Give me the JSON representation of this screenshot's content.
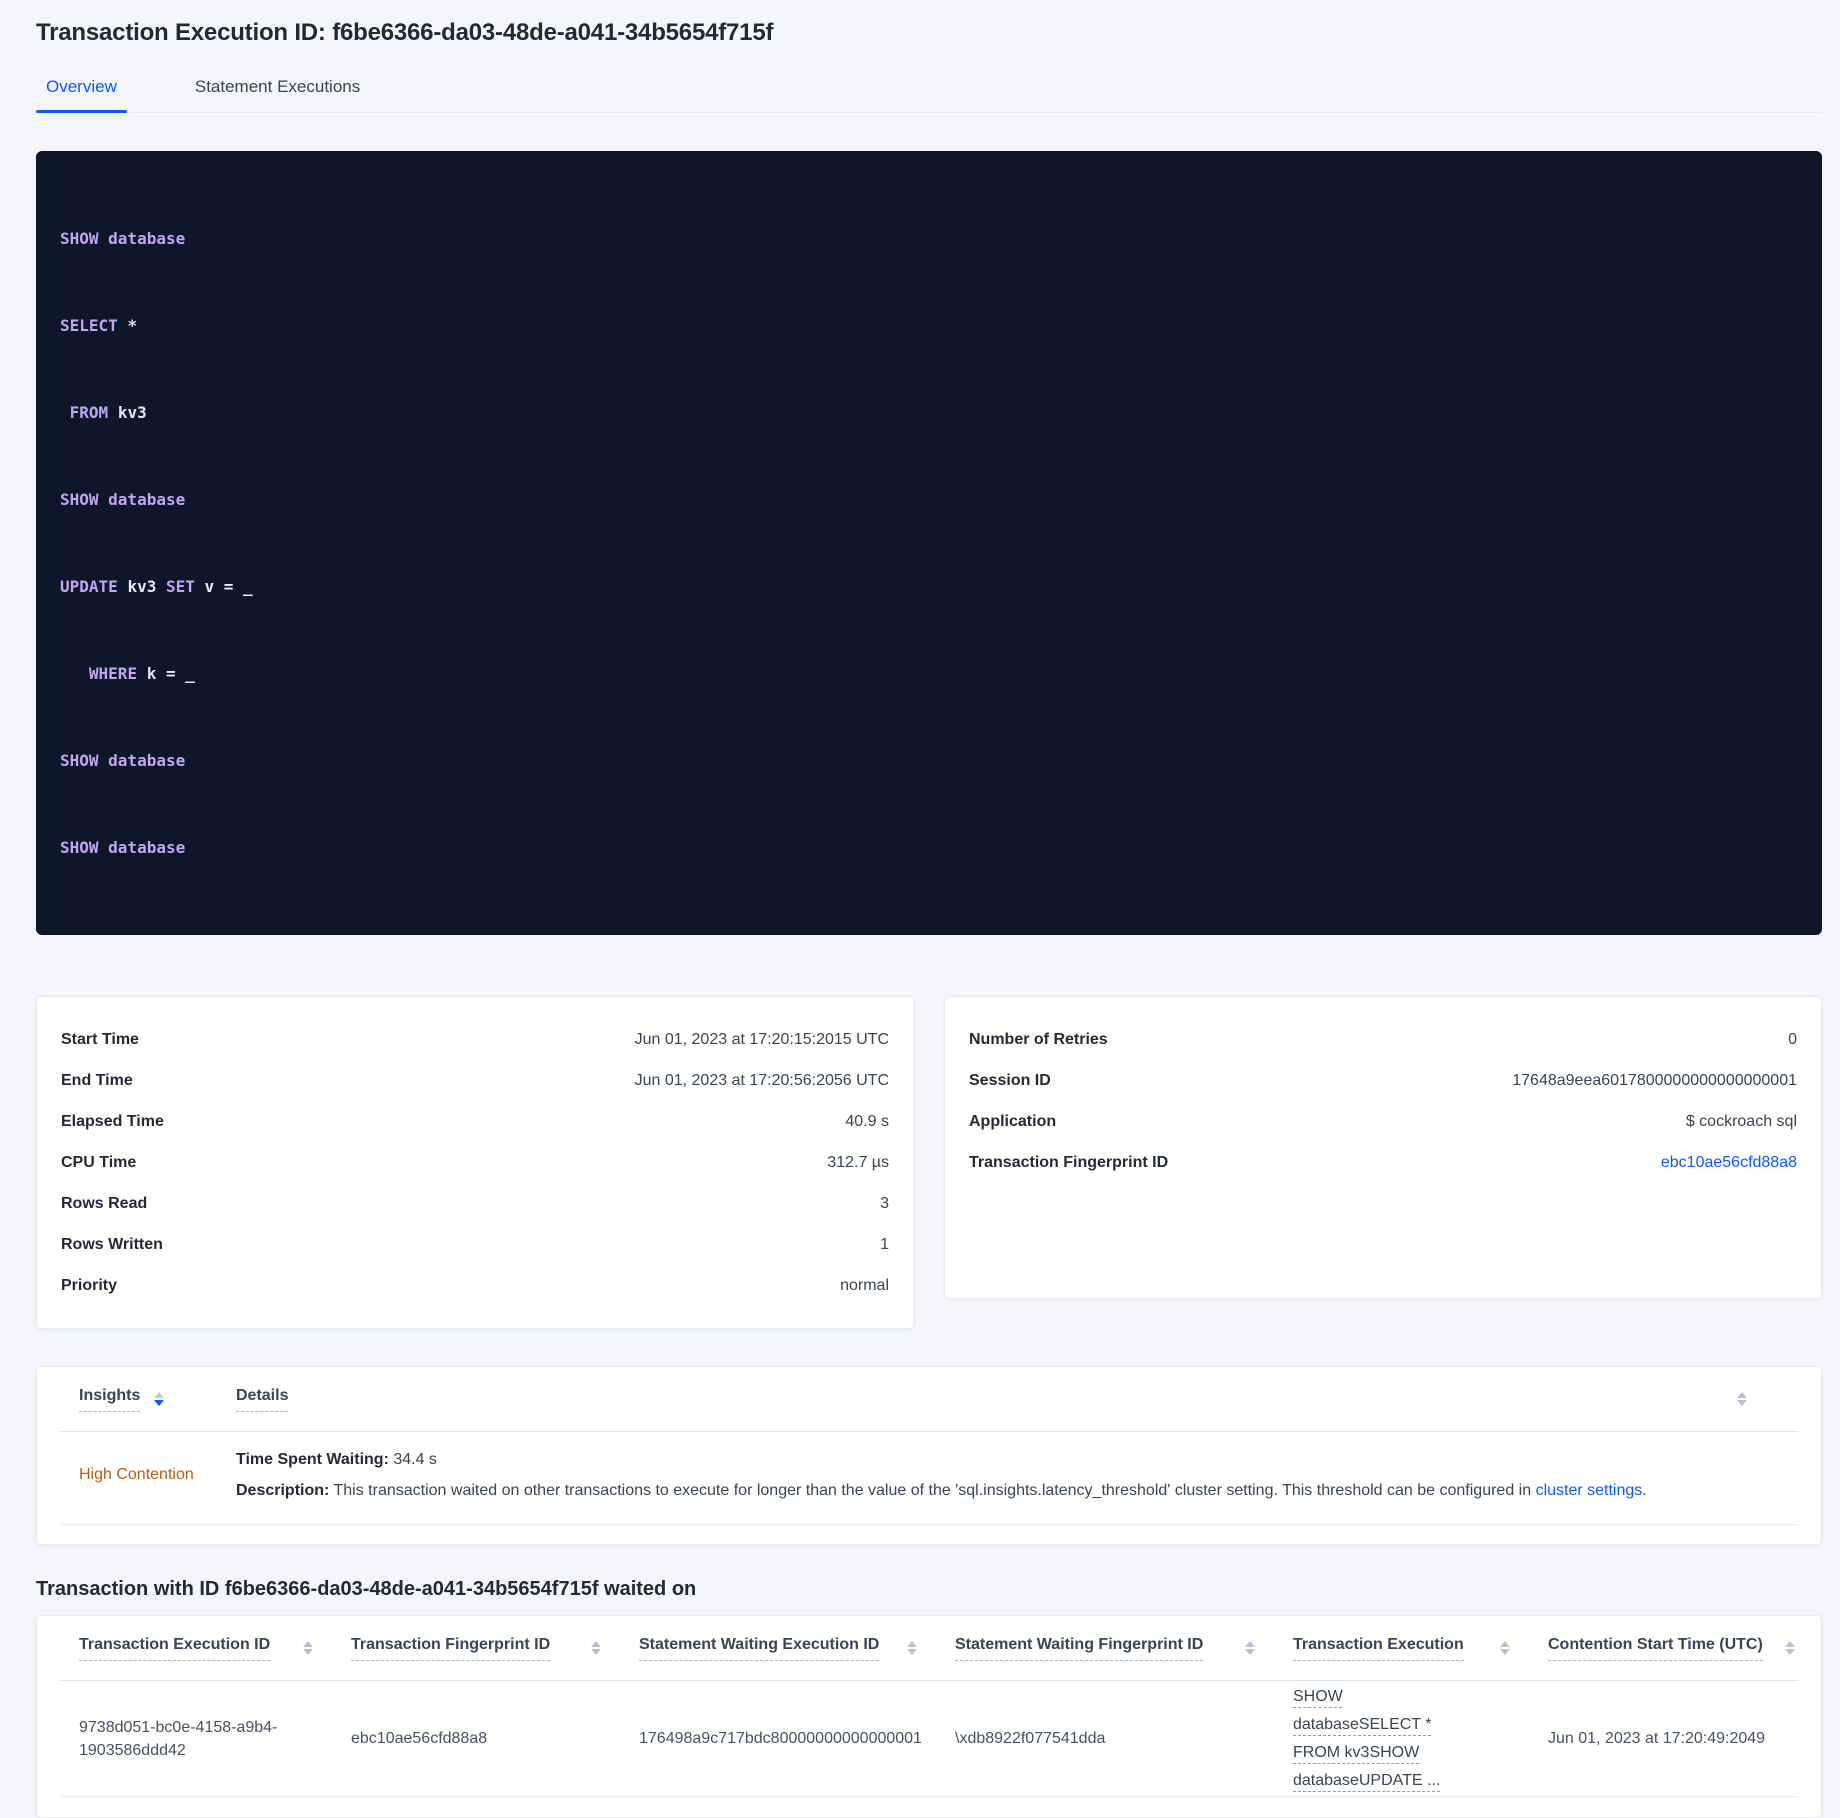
{
  "colors": {
    "accent_blue": "#0b5aff",
    "insight_orange": "#bf5b0f",
    "sql_box_bg": "#0e1729",
    "sql_keyword": "#c3a4f2",
    "sql_identifier": "#e7e9f3",
    "page_bg": "#f4f6fb"
  },
  "header": {
    "title": "Transaction Execution ID: f6be6366-da03-48de-a041-34b5654f715f",
    "tabs": [
      {
        "label": "Overview"
      },
      {
        "label": "Statement Executions"
      }
    ]
  },
  "sql": {
    "lines": [
      [
        "SHOW database"
      ],
      [
        "SELECT ",
        "*"
      ],
      [
        " ",
        "FROM ",
        "kv3"
      ],
      [
        "SHOW database"
      ],
      [
        "UPDATE ",
        "kv3 ",
        "SET ",
        "v = _"
      ],
      [
        "   ",
        "WHERE ",
        "k = _"
      ],
      [
        "SHOW database"
      ],
      [
        "SHOW database"
      ]
    ]
  },
  "details_left": {
    "rows": [
      {
        "label": "Start Time",
        "value": "Jun 01, 2023 at 17:20:15:2015 UTC"
      },
      {
        "label": "End Time",
        "value": "Jun 01, 2023 at 17:20:56:2056 UTC"
      },
      {
        "label": "Elapsed Time",
        "value": "40.9 s"
      },
      {
        "label": "CPU Time",
        "value": "312.7 µs"
      },
      {
        "label": "Rows Read",
        "value": "3"
      },
      {
        "label": "Rows Written",
        "value": "1"
      },
      {
        "label": "Priority",
        "value": "normal"
      }
    ]
  },
  "details_right": {
    "rows": [
      {
        "label": "Number of Retries",
        "value": "0"
      },
      {
        "label": "Session ID",
        "value": "17648a9eea6017800000000000000001"
      },
      {
        "label": "Application",
        "value": "$ cockroach sql"
      }
    ],
    "fingerprint_label": "Transaction Fingerprint ID",
    "fingerprint_value": "ebc10ae56cfd88a8"
  },
  "insights": {
    "columns": {
      "insights": "Insights",
      "details": "Details"
    },
    "row": {
      "insight_label": "High Contention",
      "waiting_label": "Time Spent Waiting:",
      "waiting_value": " 34.4 s",
      "description_label": "Description:",
      "description_text": " This transaction waited on other transactions to execute for longer than the value of the 'sql.insights.latency_threshold' cluster setting. This threshold can be configured in ",
      "description_link": "cluster settings",
      "description_suffix": "."
    }
  },
  "waited": {
    "heading": "Transaction with ID f6be6366-da03-48de-a041-34b5654f715f waited on",
    "columns": [
      "Transaction Execution ID",
      "Transaction Fingerprint ID",
      "Statement Waiting Execution ID",
      "Statement Waiting Fingerprint ID",
      "Transaction Execution",
      "Contention Start Time (UTC)"
    ],
    "row": {
      "txn_execution_id": "9738d051-bc0e-4158-a9b4-1903586ddd42",
      "txn_fingerprint_id": "ebc10ae56cfd88a8",
      "stmt_waiting_execution_id": "176498a9c717bdc80000000000000001",
      "stmt_waiting_fingerprint_id": "\\xdb8922f077541dda",
      "txn_execution": "SHOW databaseSELECT * FROM kv3SHOW databaseUPDATE ...",
      "contention_start": "Jun 01, 2023 at 17:20:49:2049"
    }
  }
}
